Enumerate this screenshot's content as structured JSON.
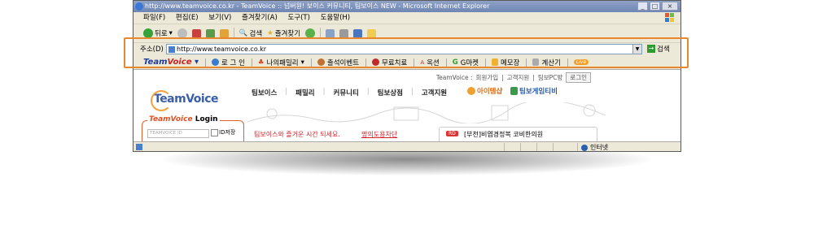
{
  "window": {
    "title": "http://www.teamvoice.co.kr - TeamVoice :: 넘버원! 보이스 커뮤니티, 팀보이스 NEW - Microsoft Internet Explorer",
    "controls": [
      "_",
      "□",
      "×"
    ]
  },
  "menu": {
    "items": [
      "파일(F)",
      "편집(E)",
      "보기(V)",
      "즐겨찾기(A)",
      "도구(T)",
      "도움말(H)"
    ]
  },
  "toolbar": {
    "back_label": "뒤로",
    "search_label": "검색",
    "favorites_label": "즐겨찾기"
  },
  "address": {
    "label": "주소(D)",
    "value": "http://www.teamvoice.co.kr",
    "go_label": "검색"
  },
  "links": {
    "logo_team": "Team",
    "logo_voice": "Voice",
    "items": [
      "로 그 인",
      "나의패밀리",
      "출석이벤트",
      "무료치료",
      "옥션",
      "G마켓",
      "메모장",
      "계산기",
      "Live"
    ]
  },
  "page": {
    "top_links": [
      "TeamVoice :",
      "회원가입",
      "고객지원",
      "팀보PC방",
      "로그인"
    ],
    "brand": "TeamVoice",
    "nav": [
      "팀보이스",
      "패밀리",
      "커뮤니티",
      "팀보상점",
      "고객지원"
    ],
    "promo_1": "아이템샵",
    "promo_2": "팀보게임티비",
    "login_title_em": "TeamVoice",
    "login_title": "Login",
    "id_placeholder": "TEAMVOICE ID",
    "id_save": "ID저장",
    "notice": "팀보이스와 즐거운 시간 되세요.",
    "notice_link": "명의도용차단",
    "news_tag": "RD",
    "news_text": "[부천]비엽경정복 코비한의원"
  },
  "status": {
    "zone": "인터넷"
  },
  "colors": {
    "highlight": "#e8882e",
    "brand_blue": "#1f3c9c",
    "notice_red": "#d2222a"
  }
}
